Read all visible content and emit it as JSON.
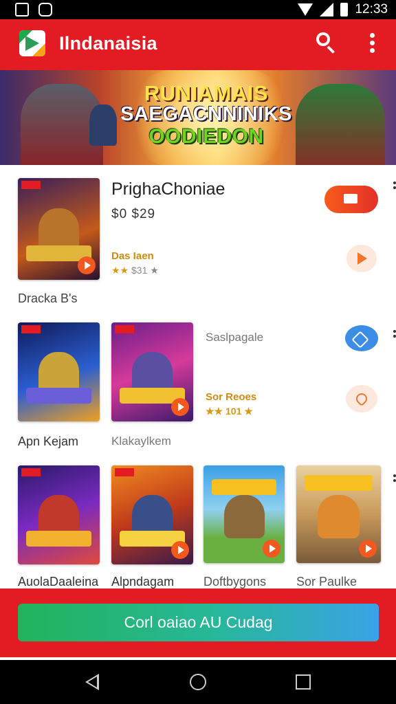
{
  "status_bar": {
    "time": "12:33"
  },
  "app_bar": {
    "title": "Ilndanaisia"
  },
  "banner": {
    "line1": "RUNIAMAIS",
    "line2": "SAEGACNNINIKS",
    "line3": "OODIEDON"
  },
  "featured": {
    "title": "PrighaChoniae",
    "price": "$0 $29",
    "developer": "Das Iaen",
    "stars_text": "$31",
    "caption": "Dracka B's"
  },
  "row2": {
    "items": [
      {
        "label": "Apn Kejam"
      },
      {
        "label": "Klakaylkem"
      }
    ],
    "side_label": "Saslpagale",
    "side_gold": "Sor Reoes",
    "side_rating": "101"
  },
  "row3": {
    "items": [
      {
        "label": "AuolaDaaleina"
      },
      {
        "label": "Alpndagam"
      },
      {
        "label": "Doftbygons"
      },
      {
        "label": "Sor Paulke"
      }
    ]
  },
  "cta": {
    "label": "Corl oaiao AU Cudag"
  },
  "colors": {
    "primary": "#e31b23",
    "accent": "#f2581f",
    "cta_start": "#22b35a",
    "cta_end": "#3aa2e6"
  }
}
